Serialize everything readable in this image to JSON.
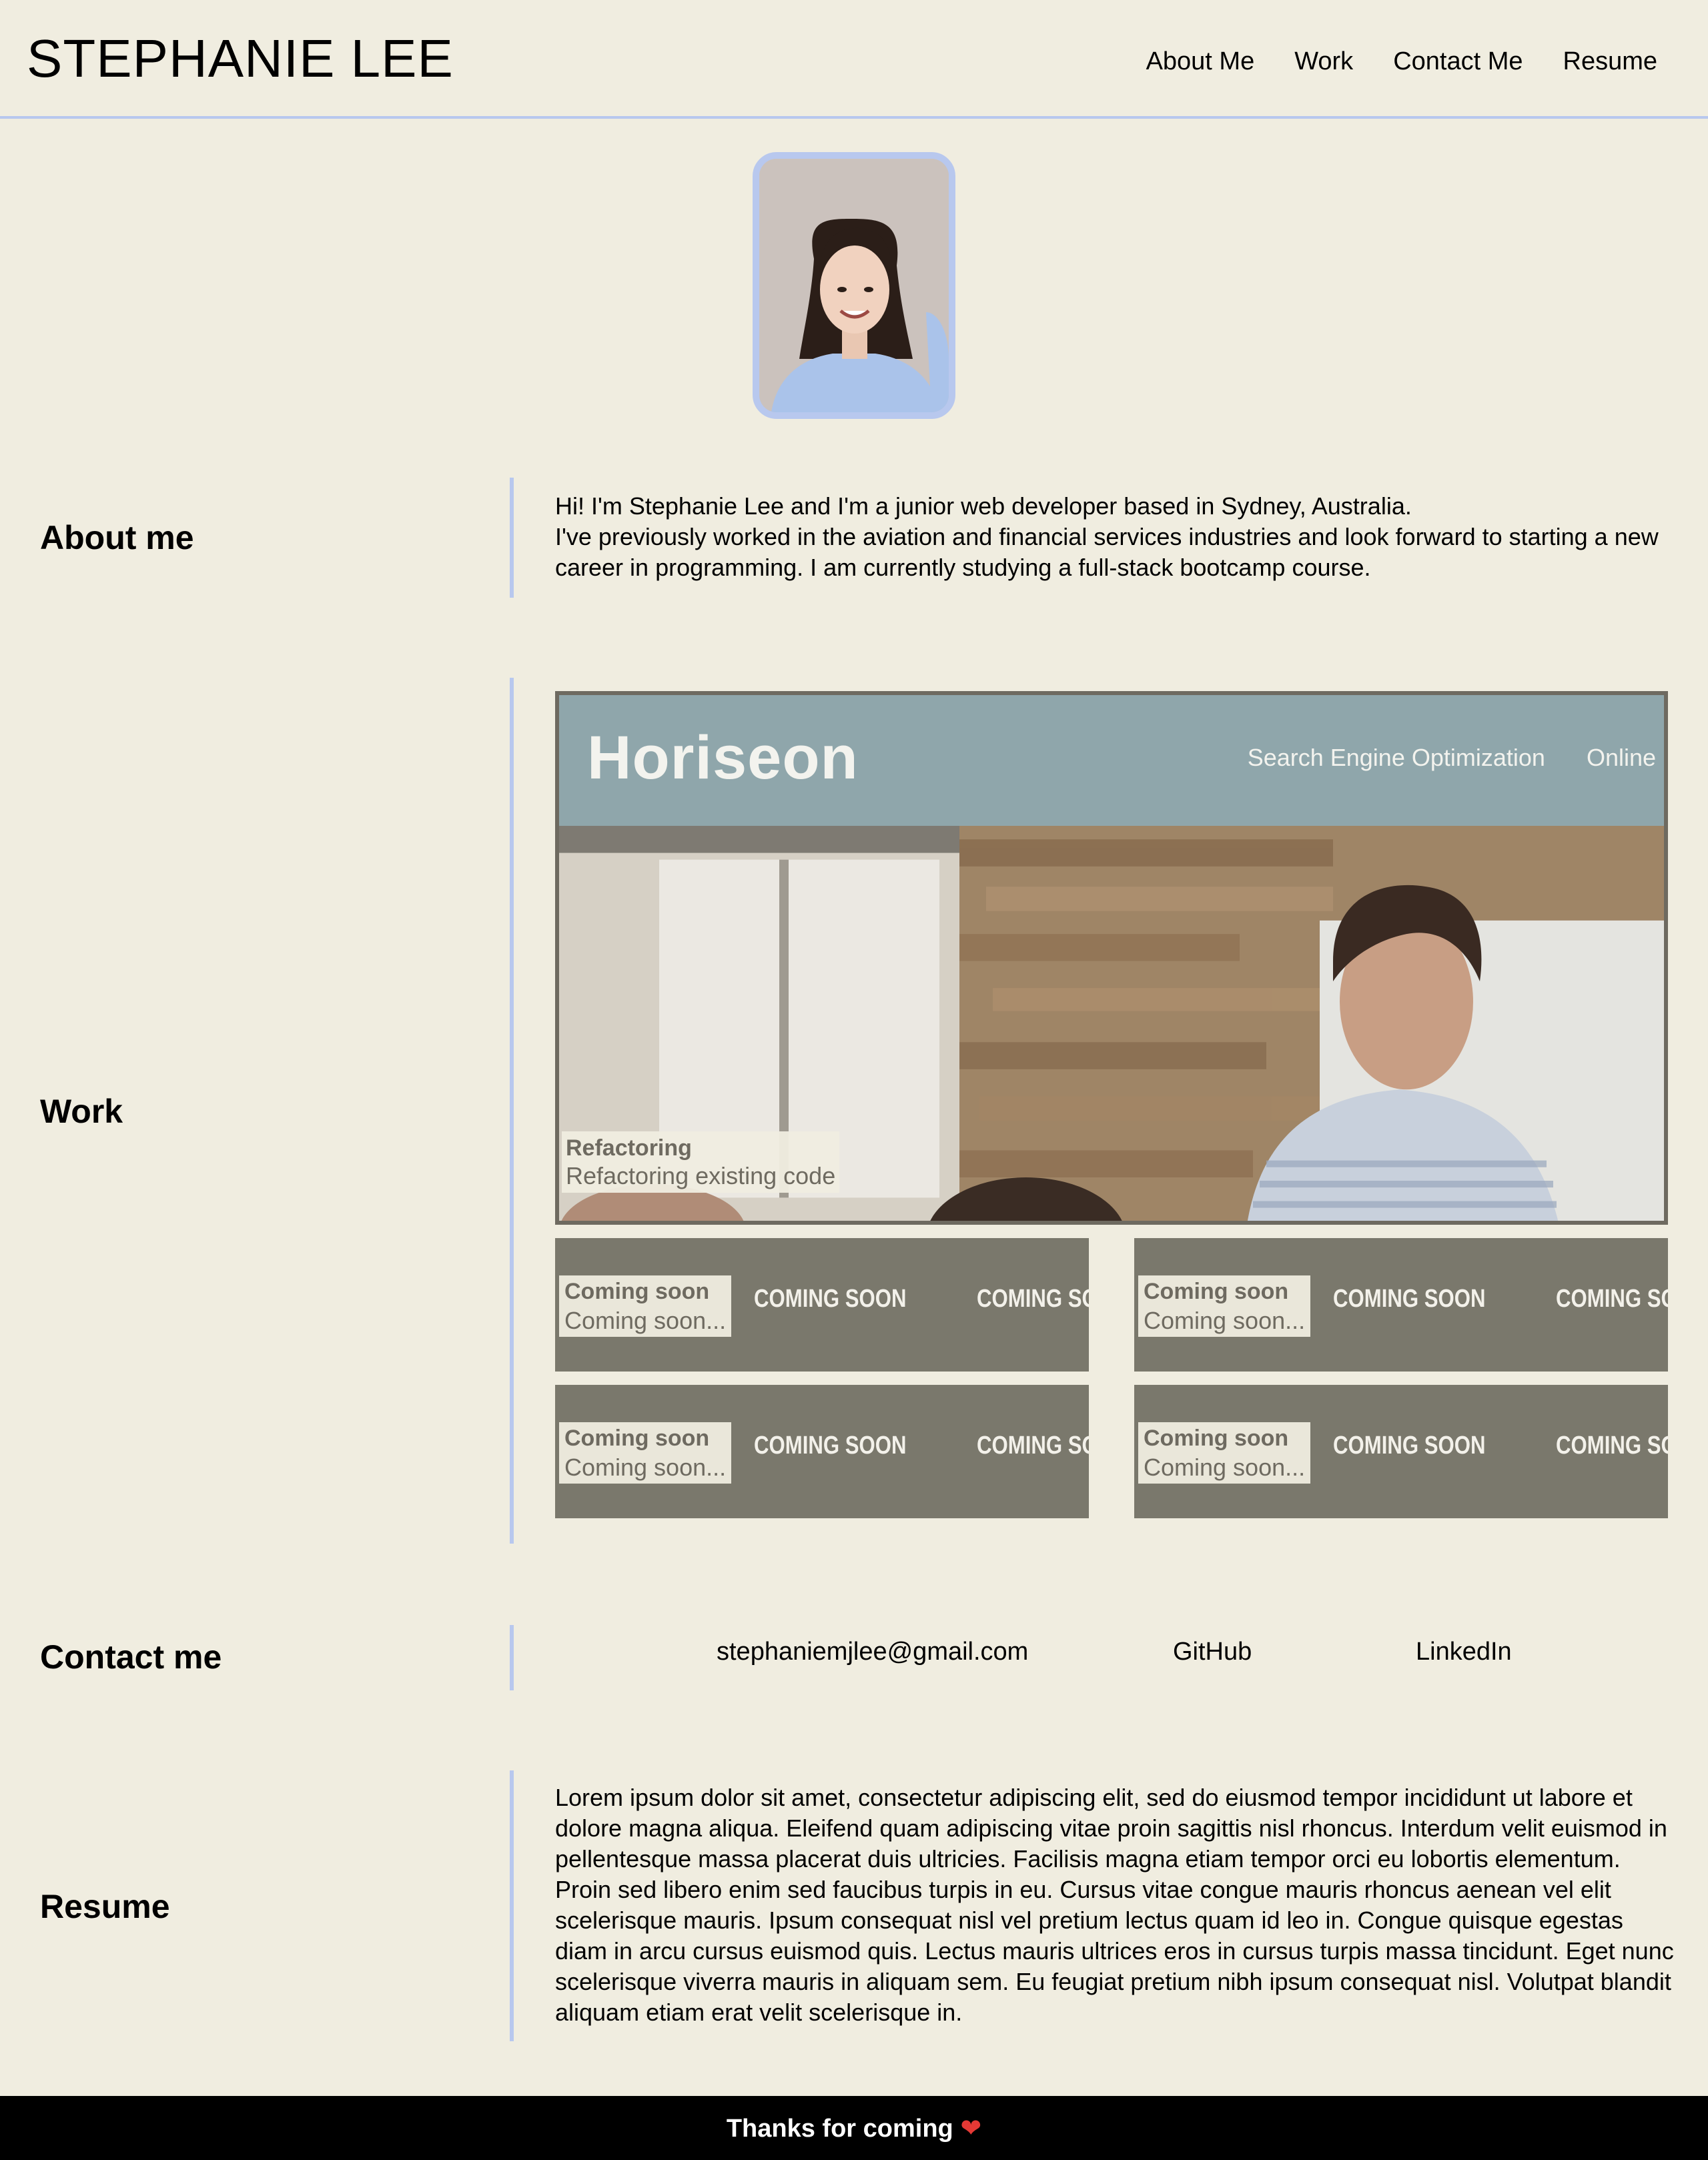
{
  "header": {
    "brand": "STEPHANIE LEE",
    "nav": [
      "About Me",
      "Work",
      "Contact Me",
      "Resume"
    ]
  },
  "avatar": {
    "alt": "Portrait photo"
  },
  "about": {
    "label": "About me",
    "line1": "Hi! I'm Stephanie Lee and I'm a junior web developer based in Sydney, Australia.",
    "line2": "I've previously worked in the aviation and financial services industries and look forward to starting a new career in programming. I am currently studying a full-stack bootcamp course."
  },
  "work": {
    "label": "Work",
    "feature": {
      "screenshot_logo": "Horiseon",
      "screenshot_nav": [
        "Search Engine Optimization",
        "Online"
      ],
      "title": "Refactoring",
      "description": "Refactoring existing code"
    },
    "tiles": [
      {
        "title": "Coming soon",
        "description": "Coming soon...",
        "banner": [
          "COMING SOON",
          "COMING SO"
        ]
      },
      {
        "title": "Coming soon",
        "description": "Coming soon...",
        "banner": [
          "COMING SOON",
          "COMING SO"
        ]
      },
      {
        "title": "Coming soon",
        "description": "Coming soon...",
        "banner": [
          "COMING SOON",
          "COMING SO"
        ]
      },
      {
        "title": "Coming soon",
        "description": "Coming soon...",
        "banner": [
          "COMING SOON",
          "COMING SO"
        ]
      }
    ]
  },
  "contact": {
    "label": "Contact me",
    "email": "stephaniemjlee@gmail.com",
    "github": "GitHub",
    "linkedin": "LinkedIn"
  },
  "resume": {
    "label": "Resume",
    "text": "Lorem ipsum dolor sit amet, consectetur adipiscing elit, sed do eiusmod tempor incididunt ut labore et dolore magna aliqua. Eleifend quam adipiscing vitae proin sagittis nisl rhoncus. Interdum velit euismod in pellentesque massa placerat duis ultricies. Facilisis magna etiam tempor orci eu lobortis elementum. Proin sed libero enim sed faucibus turpis in eu. Cursus vitae congue mauris rhoncus aenean vel elit scelerisque mauris. Ipsum consequat nisl vel pretium lectus quam id leo in. Congue quisque egestas diam in arcu cursus euismod quis. Lectus mauris ultrices eros in cursus turpis massa tincidunt. Eget nunc scelerisque viverra mauris in aliquam sem. Eu feugiat pretium nibh ipsum consequat nisl. Volutpat blandit aliquam etiam erat velit scelerisque in."
  },
  "footer": {
    "text": "Thanks for coming",
    "icon": "heart-icon"
  },
  "colors": {
    "background": "#f0ede0",
    "accent": "#b8c8ee",
    "tile": "#7a786c",
    "footer": "#000000"
  }
}
